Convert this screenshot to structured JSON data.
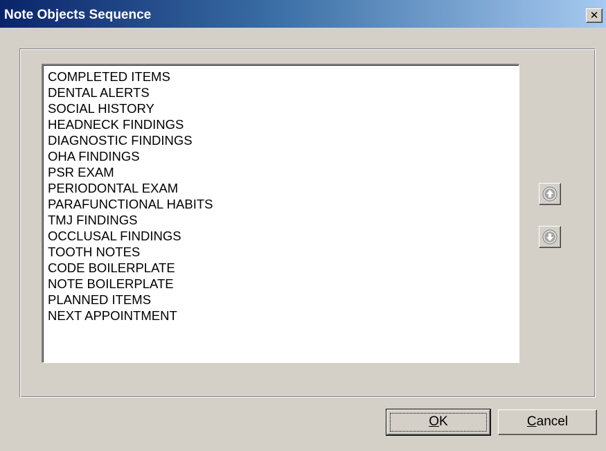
{
  "window": {
    "title": "Note Objects Sequence",
    "close_symbol": "✕"
  },
  "list": {
    "items": [
      "COMPLETED ITEMS",
      "DENTAL ALERTS",
      "SOCIAL HISTORY",
      "HEADNECK FINDINGS",
      "DIAGNOSTIC FINDINGS",
      "OHA FINDINGS",
      "PSR EXAM",
      "PERIODONTAL EXAM",
      "PARAFUNCTIONAL HABITS",
      "TMJ FINDINGS",
      "OCCLUSAL FINDINGS",
      "TOOTH NOTES",
      "CODE BOILERPLATE",
      "NOTE BOILERPLATE",
      "PLANNED ITEMS",
      "NEXT APPOINTMENT"
    ]
  },
  "controls": {
    "move_up_icon": "arrow-up-circle-icon",
    "move_down_icon": "arrow-down-circle-icon"
  },
  "buttons": {
    "ok_mnemonic": "O",
    "ok_rest": "K",
    "cancel_mnemonic": "C",
    "cancel_rest": "ancel"
  },
  "colors": {
    "titlebar_start": "#0a246a",
    "titlebar_end": "#a6caf0",
    "face": "#d4d0c8",
    "arrow_icon": "#a0a0a0"
  }
}
